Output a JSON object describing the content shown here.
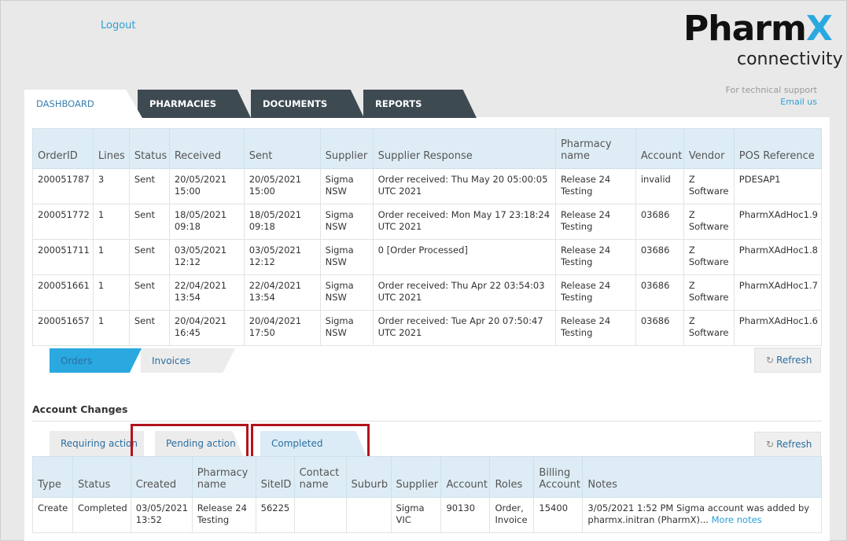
{
  "header": {
    "logout": "Logout",
    "logo_main": "Pharm",
    "logo_x": "X",
    "logo_sub": "connectivity",
    "support_text": "For technical support",
    "support_link": "Email us"
  },
  "tabs": [
    "DASHBOARD",
    "PHARMACIES",
    "DOCUMENTS",
    "REPORTS"
  ],
  "orders": {
    "columns": [
      "OrderID",
      "Lines",
      "Status",
      "Received",
      "Sent",
      "Supplier",
      "Supplier Response",
      "Pharmacy name",
      "Account",
      "Vendor",
      "POS Reference"
    ],
    "rows": [
      [
        "200051787",
        "3",
        "Sent",
        "20/05/2021 15:00",
        "20/05/2021 15:00",
        "Sigma NSW",
        "Order received: Thu May 20 05:00:05 UTC 2021",
        "Release 24 Testing",
        "invalid",
        "Z Software",
        "PDESAP1"
      ],
      [
        "200051772",
        "1",
        "Sent",
        "18/05/2021 09:18",
        "18/05/2021 09:18",
        "Sigma NSW",
        "Order received: Mon May 17 23:18:24 UTC 2021",
        "Release 24 Testing",
        "03686",
        "Z Software",
        "PharmXAdHoc1.9"
      ],
      [
        "200051711",
        "1",
        "Sent",
        "03/05/2021 12:12",
        "03/05/2021 12:12",
        "Sigma NSW",
        "0 [Order Processed]",
        "Release 24 Testing",
        "03686",
        "Z Software",
        "PharmXAdHoc1.8"
      ],
      [
        "200051661",
        "1",
        "Sent",
        "22/04/2021 13:54",
        "22/04/2021 13:54",
        "Sigma NSW",
        "Order received: Thu Apr 22 03:54:03 UTC 2021",
        "Release 24 Testing",
        "03686",
        "Z Software",
        "PharmXAdHoc1.7"
      ],
      [
        "200051657",
        "1",
        "Sent",
        "20/04/2021 16:45",
        "20/04/2021 17:50",
        "Sigma NSW",
        "Order received: Tue Apr 20 07:50:47 UTC 2021",
        "Release 24 Testing",
        "03686",
        "Z Software",
        "PharmXAdHoc1.6"
      ]
    ],
    "subtabs": [
      "Orders",
      "Invoices"
    ],
    "refresh": "Refresh"
  },
  "account_changes": {
    "title": "Account Changes",
    "tabs": [
      "Requiring action",
      "Pending action",
      "Completed"
    ],
    "refresh": "Refresh",
    "columns": [
      "Type",
      "Status",
      "Created",
      "Pharmacy name",
      "SiteID",
      "Contact name",
      "Suburb",
      "Supplier",
      "Account",
      "Roles",
      "Billing Account",
      "Notes"
    ],
    "rows": [
      [
        "Create",
        "Completed",
        "03/05/2021 13:52",
        "Release 24 Testing",
        "56225",
        "",
        "",
        "Sigma VIC",
        "90130",
        "Order, Invoice",
        "15400",
        "3/05/2021 1:52 PM Sigma account was added by pharmx.initran (PharmX)..."
      ]
    ],
    "more_notes": "More notes"
  },
  "colors": {
    "accent": "#2aa8e0",
    "dark_tab": "#3e4a52",
    "highlight": "#b1141c"
  },
  "icons": {
    "refresh": "refresh-icon"
  }
}
